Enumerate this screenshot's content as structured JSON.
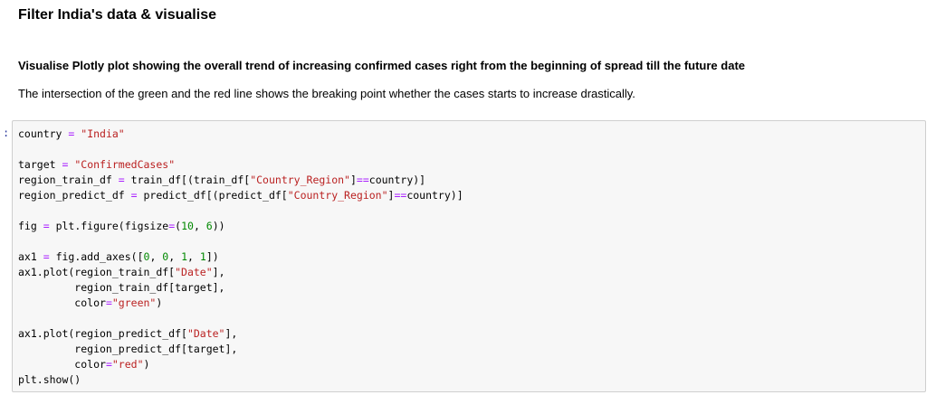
{
  "heading": "Filter India's data & visualise",
  "subheading": "Visualise Plotly plot showing the overall trend of increasing confirmed cases right from the beginning of spread till the future date",
  "description": "The intersection of the green and the red line shows the breaking point whether the cases starts to increase drastically.",
  "prompt": ":",
  "code_lines": [
    "country = \"India\"",
    "",
    "target = \"ConfirmedCases\"",
    "region_train_df = train_df[(train_df[\"Country_Region\"]==country)]",
    "region_predict_df = predict_df[(predict_df[\"Country_Region\"]==country)]",
    "",
    "fig = plt.figure(figsize=(10, 6))",
    "",
    "ax1 = fig.add_axes([0, 0, 1, 1])",
    "ax1.plot(region_train_df[\"Date\"],",
    "         region_train_df[target],",
    "         color=\"green\")",
    "",
    "ax1.plot(region_predict_df[\"Date\"],",
    "         region_predict_df[target],",
    "         color=\"red\")",
    "plt.show()"
  ],
  "colors": {
    "string": "#ba2121",
    "number": "#008800",
    "operator": "#aa22ff",
    "prompt": "#303f9f",
    "cell_background": "#f7f7f7",
    "cell_border": "#cfcfcf"
  }
}
